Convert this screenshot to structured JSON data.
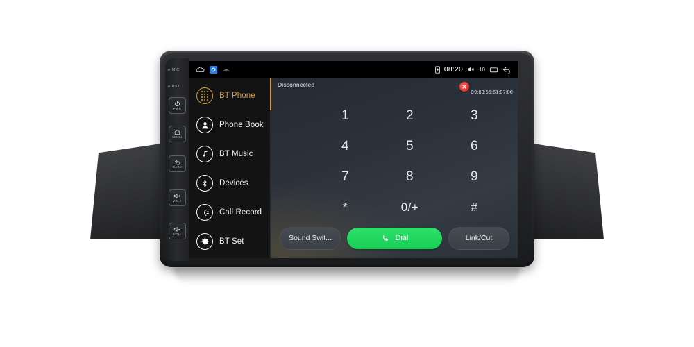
{
  "device": {
    "bezel_keys": [
      {
        "name": "mic-indicator",
        "label": "MIC",
        "type": "dot"
      },
      {
        "name": "reset-indicator",
        "label": "RST",
        "type": "dot"
      },
      {
        "name": "power-key",
        "label": "PWR",
        "icon": "power-icon"
      },
      {
        "name": "menu-key",
        "label": "MENU",
        "icon": "home-icon"
      },
      {
        "name": "back-key",
        "label": "BACK",
        "icon": "back-arrow-icon"
      },
      {
        "name": "volume-up-key",
        "label": "VOL+",
        "icon": "speaker-plus-icon"
      },
      {
        "name": "volume-down-key",
        "label": "VOL-",
        "icon": "speaker-minus-icon"
      }
    ]
  },
  "statusbar": {
    "home_icon": "home-outline-icon",
    "app_icon_glyph": "O",
    "cast_icon": "cast-icon",
    "battery_icon": "battery-icon",
    "time": "08:20",
    "volume_icon": "volume-icon",
    "volume_level": "10",
    "recents_icon": "recents-icon",
    "back_icon": "back-arrow-icon"
  },
  "sidebar": {
    "items": [
      {
        "label": "BT Phone",
        "icon": "dialpad-icon",
        "selected": true
      },
      {
        "label": "Phone Book",
        "icon": "contact-icon",
        "selected": false
      },
      {
        "label": "BT Music",
        "icon": "music-note-icon",
        "selected": false
      },
      {
        "label": "Devices",
        "icon": "bluetooth-icon",
        "selected": false
      },
      {
        "label": "Call Record",
        "icon": "call-log-icon",
        "selected": false
      },
      {
        "label": "BT Set",
        "icon": "gear-icon",
        "selected": false
      }
    ]
  },
  "pane": {
    "connection_status": "Disconnected",
    "mac_address": "C9:83:65:61:87:00",
    "disconnect_icon": "close-icon"
  },
  "keypad": {
    "keys": [
      "1",
      "2",
      "3",
      "4",
      "5",
      "6",
      "7",
      "8",
      "9",
      "*",
      "0/+",
      "#"
    ]
  },
  "actions": {
    "sound_switch_label": "Sound Swit...",
    "dial_label": "Dial",
    "dial_icon": "phone-icon",
    "link_cut_label": "Link/Cut"
  },
  "colors": {
    "accent_orange": "#d99b3c",
    "call_green": "#1ed760",
    "disconnect_red": "#d4221a",
    "app_blue": "#2a7fe6"
  }
}
